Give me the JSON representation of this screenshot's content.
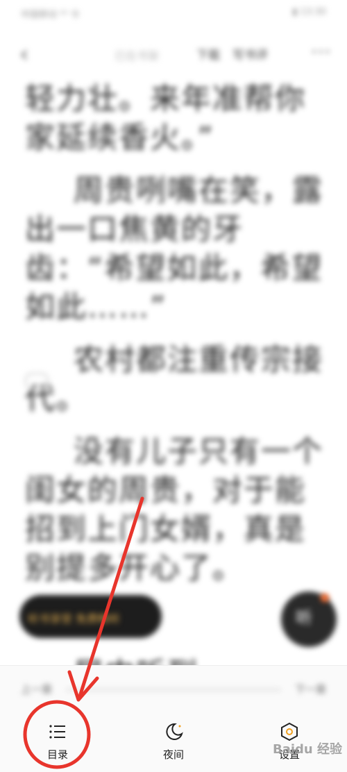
{
  "status_bar": {
    "left": "中国移动 ⁴ᴳ 令",
    "right": "▮ 13:30"
  },
  "top_bar": {
    "chapter_hint": "已在书架",
    "download": "下载",
    "review": "写书评"
  },
  "content": {
    "paragraphs": [
      "轻力壮。来年准帮你家延续香火。”",
      "周贵咧嘴在笑，露出一口焦黄的牙齿：“希望如此，希望如此……”",
      "农村都注重传宗接代。",
      "没有儿子只有一个闺女的周贵，对于能招到上门女婿，真是别提多开心了。",
      "……",
      "屋内听到"
    ]
  },
  "audio_banner": {
    "text": "听书享受 免费畅听"
  },
  "listen_button": {
    "label": "听"
  },
  "chapter_nav": {
    "prev": "上一章",
    "next": "下一章",
    "progress": 0
  },
  "bottom_nav": [
    {
      "label": "目录",
      "icon": "catalog-icon"
    },
    {
      "label": "夜间",
      "icon": "moon-icon"
    },
    {
      "label": "设置",
      "icon": "settings-icon"
    }
  ],
  "annotation": {
    "highlight": "red",
    "color": "#e8352c"
  },
  "watermark": "Baidu 经验"
}
